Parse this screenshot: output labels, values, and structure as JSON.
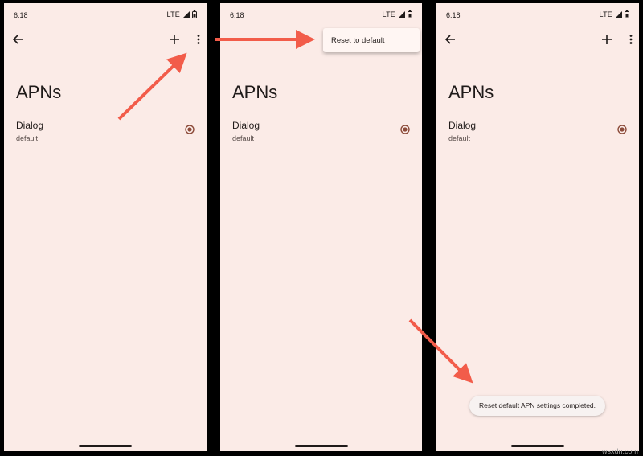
{
  "colors": {
    "frame": "#000000",
    "screen_bg": "#fbebe7",
    "accent": "#8c4b3a",
    "arrow": "#f25c4a"
  },
  "status_bar": {
    "time": "6:18",
    "network": "LTE"
  },
  "icons": {
    "back": "arrow-back-icon",
    "add": "plus-icon",
    "more": "more-vert-icon",
    "signal": "signal-icon",
    "battery": "battery-icon",
    "radio": "radio-selected-icon"
  },
  "page": {
    "title": "APNs"
  },
  "apn": {
    "name": "Dialog",
    "type": "default",
    "selected": true
  },
  "overflow_menu": {
    "items": [
      "Reset to default"
    ]
  },
  "toast": {
    "message": "Reset default APN settings completed."
  },
  "watermark": "wsxdn.com"
}
